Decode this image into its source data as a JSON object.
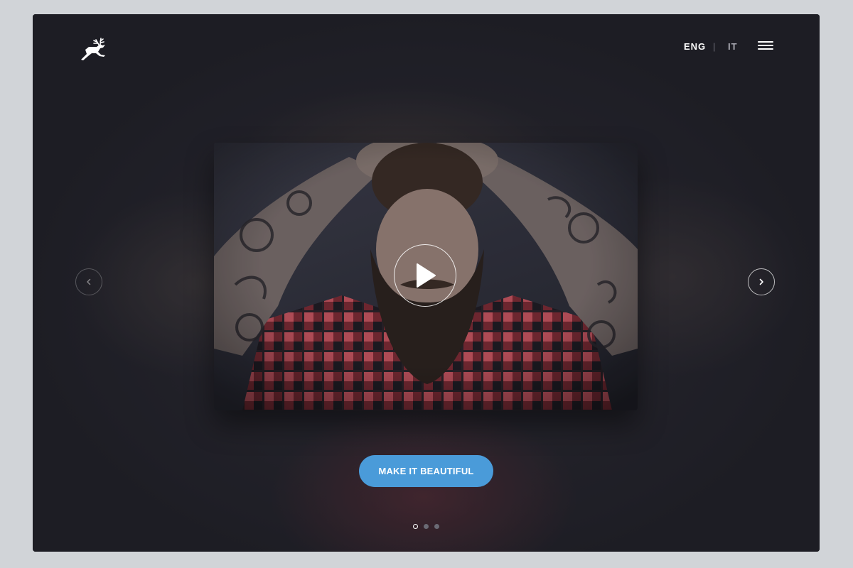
{
  "header": {
    "logo_icon": "deer-logo-icon",
    "languages": [
      {
        "label": "ENG",
        "active": true
      },
      {
        "label": "IT",
        "active": false
      }
    ],
    "separator": "|",
    "menu_icon": "hamburger-menu-icon"
  },
  "slider": {
    "prev_icon": "chevron-left-icon",
    "next_icon": "chevron-right-icon",
    "play_icon": "play-icon",
    "active_slide": 1,
    "slide_count": 3
  },
  "cta": {
    "label": "MAKE IT BEAUTIFUL"
  },
  "colors": {
    "accent": "#4a9bd9",
    "background": "#26262e",
    "page": "#d1d4d8"
  }
}
